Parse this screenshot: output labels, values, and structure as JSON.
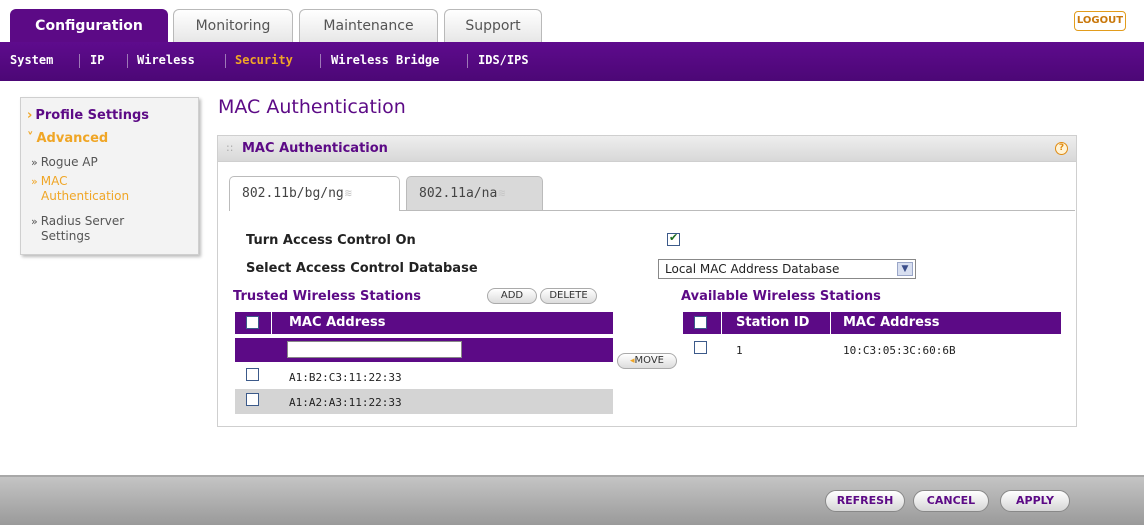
{
  "top_tabs": [
    "Configuration",
    "Monitoring",
    "Maintenance",
    "Support"
  ],
  "logout_label": "LOGOUT",
  "subnav": [
    "System",
    "IP",
    "Wireless",
    "Security",
    "Wireless Bridge",
    "IDS/IPS"
  ],
  "left_menu": {
    "profile": "Profile Settings",
    "advanced": "Advanced",
    "rogue": "Rogue AP",
    "mac1": "MAC",
    "mac2": "Authentication",
    "radius1": "Radius Server",
    "radius2": "Settings"
  },
  "page_title": "MAC Authentication",
  "panel_title": "MAC Authentication",
  "radio_tabs": [
    "802.11b/bg/ng",
    "802.11a/na"
  ],
  "form": {
    "access_control_label": "Turn Access Control On",
    "access_control_checked": true,
    "db_label": "Select Access Control Database",
    "db_value": "Local MAC Address Database"
  },
  "trusted": {
    "title": "Trusted Wireless Stations",
    "add_label": "ADD",
    "delete_label": "DELETE",
    "header": "MAC Address",
    "rows": [
      "A1:B2:C3:11:22:33",
      "A1:A2:A3:11:22:33"
    ]
  },
  "move_label": "MOVE",
  "available": {
    "title": "Available Wireless Stations",
    "headers": [
      "Station ID",
      "MAC Address"
    ],
    "rows": [
      {
        "id": "1",
        "mac": "10:C3:05:3C:60:6B"
      }
    ]
  },
  "footer_buttons": [
    "REFRESH",
    "CANCEL",
    "APPLY"
  ],
  "colors": {
    "brand_purple": "#5c0a86",
    "accent_orange": "#f0a626"
  }
}
